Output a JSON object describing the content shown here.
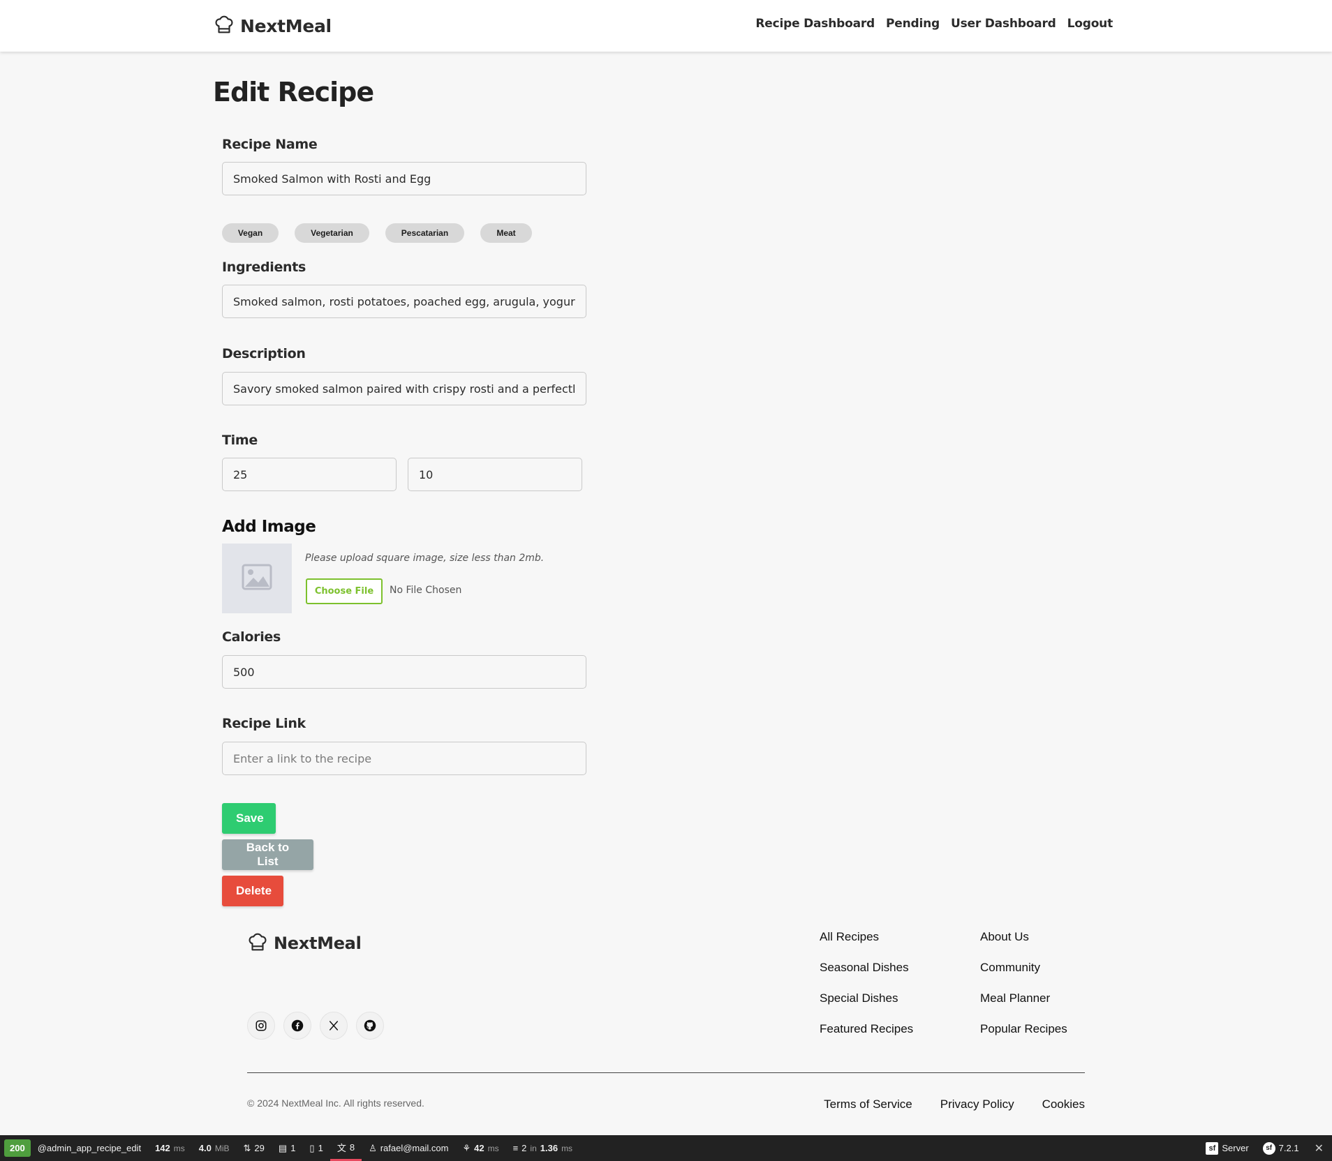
{
  "header": {
    "brand": "NextMeal",
    "nav": [
      "Recipe Dashboard",
      "Pending",
      "User Dashboard",
      "Logout"
    ]
  },
  "form": {
    "title": "Edit Recipe",
    "recipe_name": {
      "label": "Recipe Name",
      "value": "Smoked Salmon with Rosti and Egg"
    },
    "diet_tags": [
      "Vegan",
      "Vegetarian",
      "Pescatarian",
      "Meat"
    ],
    "ingredients": {
      "label": "Ingredients",
      "value": "Smoked salmon, rosti potatoes, poached egg, arugula, yogurt"
    },
    "description": {
      "label": "Description",
      "value": "Savory smoked salmon paired with crispy rosti and a perfectly"
    },
    "time": {
      "label": "Time",
      "values": [
        "25",
        "10"
      ]
    },
    "image": {
      "heading": "Add Image",
      "hint": "Please upload square image, size less than 2mb.",
      "choose_file_label": "Choose File",
      "no_file_text": "No File Chosen"
    },
    "calories": {
      "label": "Calories",
      "value": "500"
    },
    "recipe_link": {
      "label": "Recipe Link",
      "placeholder": "Enter a link to the recipe"
    },
    "buttons": {
      "save": "Save",
      "back": "Back to List",
      "delete": "Delete"
    }
  },
  "footer": {
    "brand": "NextMeal",
    "socials": [
      "instagram-icon",
      "facebook-icon",
      "x-icon",
      "github-icon"
    ],
    "col1": [
      "All Recipes",
      "Seasonal Dishes",
      "Special Dishes",
      "Featured Recipes"
    ],
    "col2": [
      "About Us",
      "Community",
      "Meal Planner",
      "Popular Recipes"
    ],
    "copyright": "© 2024 NextMeal Inc. All rights reserved.",
    "legal": [
      "Terms of Service",
      "Privacy Policy",
      "Cookies"
    ]
  },
  "toolbar": {
    "status": "200",
    "route": "@admin_app_recipe_edit",
    "time_value": "142",
    "time_unit": "ms",
    "memory_value": "4.0",
    "memory_unit": "MiB",
    "requests": "29",
    "forms": "1",
    "events": "1",
    "translations": "8",
    "user": "rafael@mail.com",
    "twig_value": "42",
    "twig_unit": "ms",
    "db_prefix": "2",
    "db_in": "in",
    "db_value": "1.36",
    "db_unit": "ms",
    "server": "Server",
    "version": "7.2.1",
    "colors": {
      "status": "#4f9e3e",
      "active": "#e84a5f"
    }
  },
  "colors": {
    "save": "#2ecc71",
    "back": "#95a5a6",
    "delete": "#e74c3c",
    "choose_file": "#7dc12e"
  }
}
